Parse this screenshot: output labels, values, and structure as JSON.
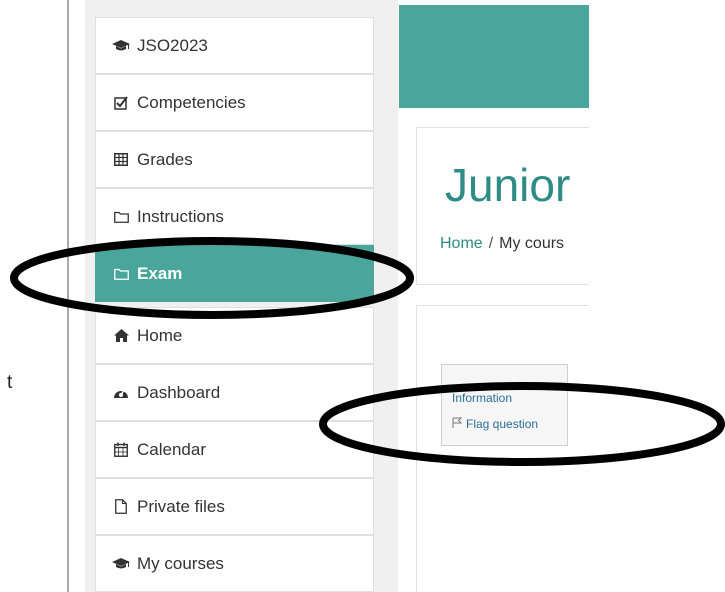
{
  "left_text": "t",
  "sidebar": {
    "items": [
      {
        "label": "JSO2023",
        "icon": "graduation-cap-icon",
        "active": false
      },
      {
        "label": "Competencies",
        "icon": "checkbox-icon",
        "active": false
      },
      {
        "label": "Grades",
        "icon": "table-icon",
        "active": false
      },
      {
        "label": "Instructions",
        "icon": "folder-icon",
        "active": false
      },
      {
        "label": "Exam",
        "icon": "folder-icon",
        "active": true
      },
      {
        "label": "Home",
        "icon": "home-icon",
        "active": false
      },
      {
        "label": "Dashboard",
        "icon": "dashboard-icon",
        "active": false
      },
      {
        "label": "Calendar",
        "icon": "calendar-icon",
        "active": false
      },
      {
        "label": "Private files",
        "icon": "file-icon",
        "active": false
      },
      {
        "label": "My courses",
        "icon": "graduation-cap-icon",
        "active": false
      }
    ]
  },
  "header": {
    "title": "Junior",
    "breadcrumb": {
      "home": "Home",
      "separator": "/",
      "current": "My cours"
    }
  },
  "question_info": {
    "title": "Information",
    "flag_label": "Flag question"
  },
  "colors": {
    "accent": "#4aa69a",
    "title": "#2e8b85",
    "link": "#2b6f9c"
  }
}
